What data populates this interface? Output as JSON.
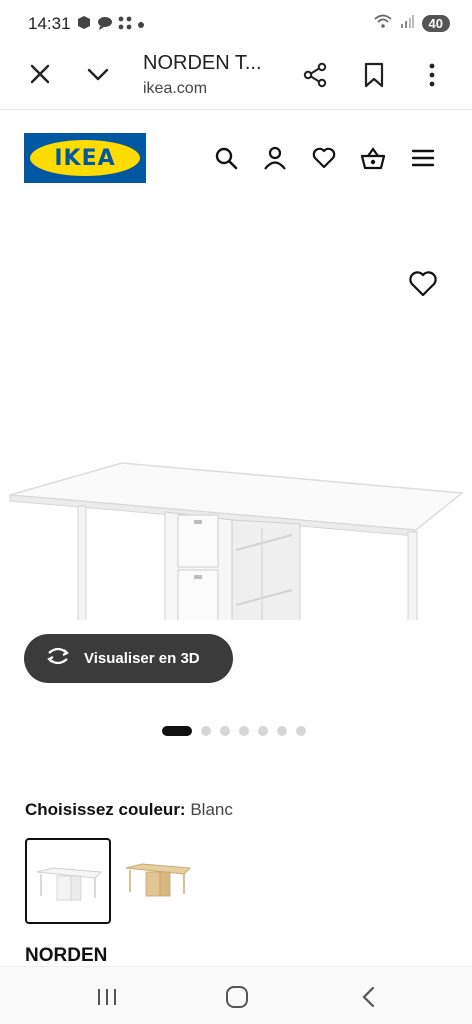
{
  "status_bar": {
    "time": "14:31",
    "battery": "40",
    "icons": [
      "notification-icon",
      "chat-icon",
      "apps-icon",
      "dot-icon",
      "wifi-icon",
      "signal-icon"
    ]
  },
  "browser": {
    "title": "NORDEN T...",
    "url": "ikea.com",
    "icons": [
      "close-icon",
      "chevron-down-icon",
      "share-icon",
      "bookmark-icon",
      "more-vertical-icon"
    ]
  },
  "header": {
    "logo_text": "IKEA",
    "logo_colors": {
      "blue": "#0058a3",
      "yellow": "#ffdb00"
    },
    "icons": [
      "search-icon",
      "user-icon",
      "heart-icon",
      "cart-icon",
      "menu-icon"
    ]
  },
  "product": {
    "view_3d_label": "Visualiser en 3D",
    "gallery_count": 7,
    "gallery_active_index": 0,
    "colour_label": "Choisissez couleur:",
    "colour_value": "Blanc",
    "swatches": [
      "white",
      "birch"
    ],
    "name": "NORDEN"
  },
  "nav_bar": {
    "icons": [
      "recents-icon",
      "home-icon",
      "back-icon"
    ]
  }
}
